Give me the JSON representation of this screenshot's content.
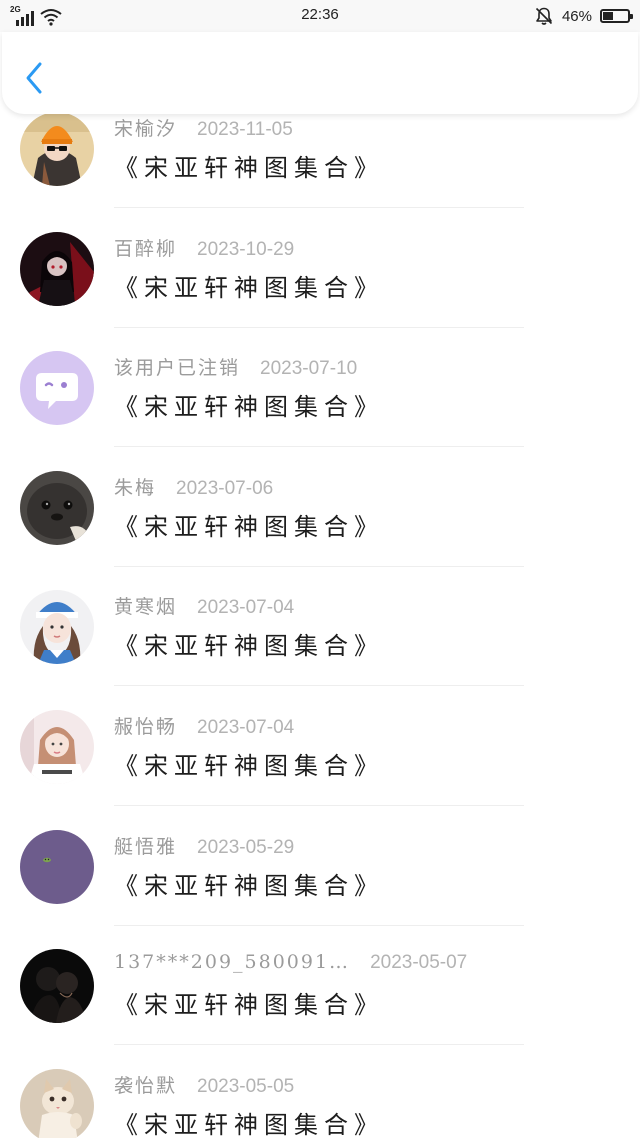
{
  "status_bar": {
    "network": "2G",
    "time": "22:36",
    "battery_percent": "46%",
    "battery_level": 0.46,
    "icons": [
      "signal-icon",
      "wifi-icon",
      "bell-muted-icon",
      "battery-icon"
    ]
  },
  "header": {
    "back_icon": "chevron-left-icon",
    "accent_color": "#2b9af3"
  },
  "comments": [
    {
      "name": "宋榆汐",
      "date": "2023-11-05",
      "title": "《宋亚轩神图集合》",
      "avatar": "orange-beanie-avatar"
    },
    {
      "name": "百醉柳",
      "date": "2023-10-29",
      "title": "《宋亚轩神图集合》",
      "avatar": "dark-anime-avatar"
    },
    {
      "name": "该用户已注销",
      "date": "2023-07-10",
      "title": "《宋亚轩神图集合》",
      "avatar": "deleted-user-avatar"
    },
    {
      "name": "朱梅",
      "date": "2023-07-06",
      "title": "《宋亚轩神图集合》",
      "avatar": "seal-avatar"
    },
    {
      "name": "黄寒烟",
      "date": "2023-07-04",
      "title": "《宋亚轩神图集合》",
      "avatar": "blue-hat-avatar"
    },
    {
      "name": "赧怡畅",
      "date": "2023-07-04",
      "title": "《宋亚轩神图集合》",
      "avatar": "girl-portrait-avatar"
    },
    {
      "name": "艇悟雅",
      "date": "2023-05-29",
      "title": "《宋亚轩神图集合》",
      "avatar": "purple-avatar"
    },
    {
      "name": "137***209_580091…",
      "date": "2023-05-07",
      "title": "《宋亚轩神图集合》",
      "avatar": "couple-silhouette-avatar"
    },
    {
      "name": "袭怡默",
      "date": "2023-05-05",
      "title": "《宋亚轩神图集合》",
      "avatar": "kitten-avatar"
    }
  ]
}
